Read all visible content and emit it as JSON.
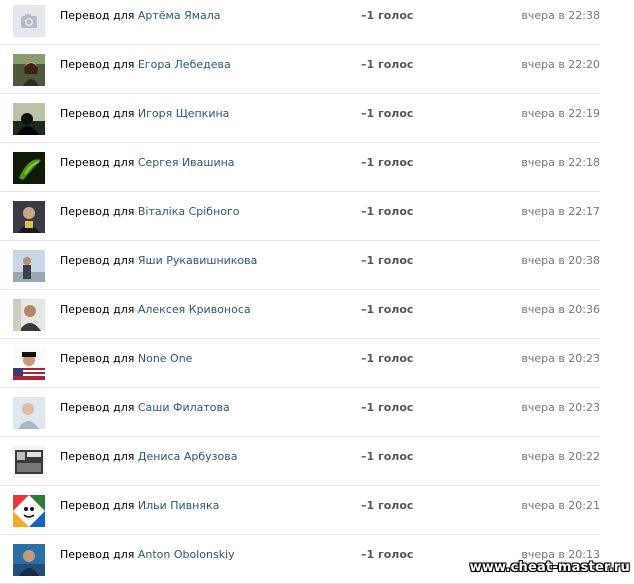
{
  "rows": [
    {
      "prefix": "Перевод для",
      "name": "Артёма Ямала",
      "votes": "–1 голос",
      "time": "вчера в 22:38",
      "avatar": "camera-placeholder-icon"
    },
    {
      "prefix": "Перевод для",
      "name": "Егора Лебедева",
      "votes": "–1 голос",
      "time": "вчера в 22:20",
      "avatar": "user-photo"
    },
    {
      "prefix": "Перевод для",
      "name": "Игоря Щепкина",
      "votes": "–1 голос",
      "time": "вчера в 22:19",
      "avatar": "user-photo"
    },
    {
      "prefix": "Перевод для",
      "name": "Сергея Ивашина",
      "votes": "–1 голос",
      "time": "вчера в 22:18",
      "avatar": "user-photo"
    },
    {
      "prefix": "Перевод для",
      "name": "Віталіка Срібного",
      "votes": "–1 голос",
      "time": "вчера в 22:17",
      "avatar": "user-photo"
    },
    {
      "prefix": "Перевод для",
      "name": "Яши Рукавишникова",
      "votes": "–1 голос",
      "time": "вчера в 20:38",
      "avatar": "user-photo"
    },
    {
      "prefix": "Перевод для",
      "name": "Алексея Кривоноса",
      "votes": "–1 голос",
      "time": "вчера в 20:36",
      "avatar": "user-photo"
    },
    {
      "prefix": "Перевод для",
      "name": "None One",
      "votes": "–1 голос",
      "time": "вчера в 20:23",
      "avatar": "user-photo"
    },
    {
      "prefix": "Перевод для",
      "name": "Саши Филатова",
      "votes": "–1 голос",
      "time": "вчера в 20:23",
      "avatar": "user-photo"
    },
    {
      "prefix": "Перевод для",
      "name": "Дениса Арбузова",
      "votes": "–1 голос",
      "time": "вчера в 20:22",
      "avatar": "user-photo"
    },
    {
      "prefix": "Перевод для",
      "name": "Ильи Пивняка",
      "votes": "–1 голос",
      "time": "вчера в 20:21",
      "avatar": "user-photo"
    },
    {
      "prefix": "Перевод для",
      "name": "Anton Obolonskiy",
      "votes": "–1 голос",
      "time": "вчера в 20:13",
      "avatar": "user-photo"
    }
  ],
  "watermark": "www.cheat-master.ru",
  "colors": {
    "link": "#2b587a",
    "votes": "#555555",
    "time": "#777777",
    "divider": "#e3e7eb"
  }
}
